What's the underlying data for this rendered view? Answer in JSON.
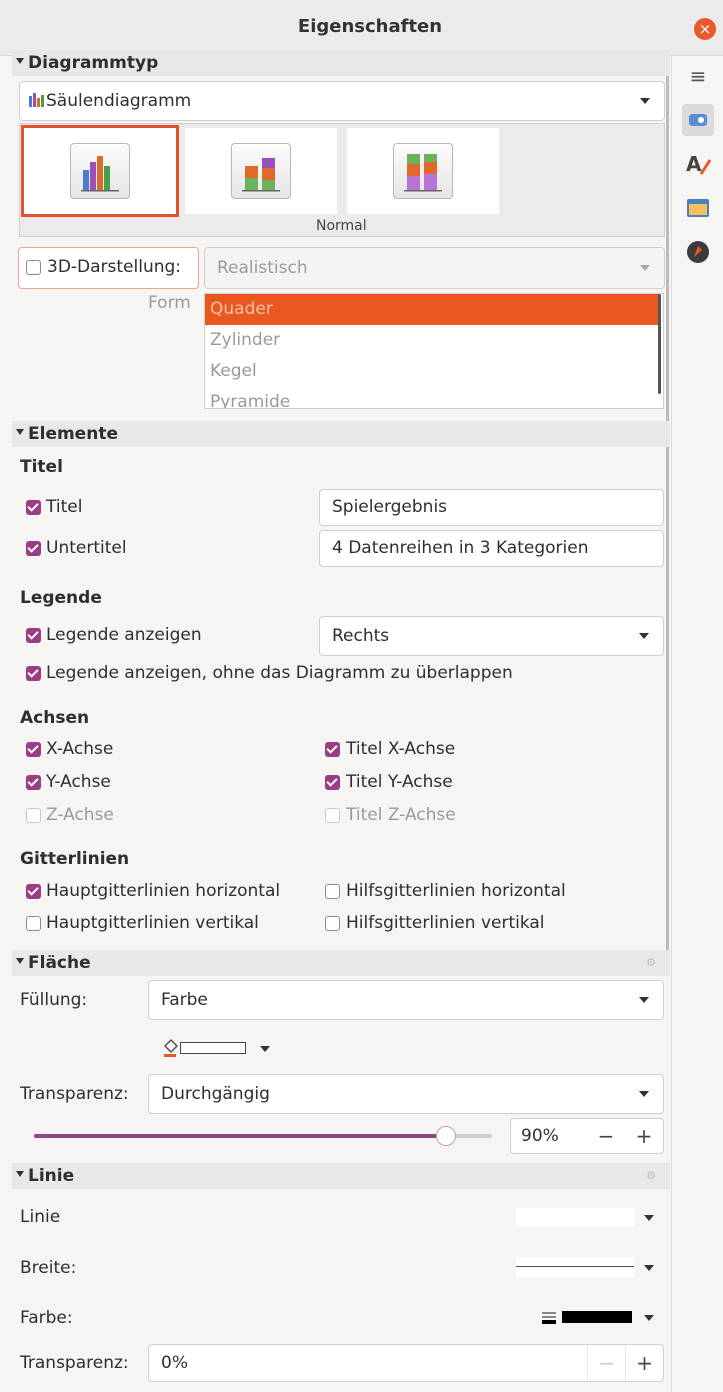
{
  "window": {
    "title": "Eigenschaften",
    "close": "×"
  },
  "sidebar": {
    "menu": "≡"
  },
  "chart_type": {
    "header": "Diagrammtyp",
    "type_value": "Säulendiagramm",
    "variant_label": "Normal",
    "threed_label": "3D-Darstellung:",
    "threed_value": "Realistisch",
    "form_label": "Form",
    "forms": [
      "Quader",
      "Zylinder",
      "Kegel",
      "Pyramide"
    ]
  },
  "elements": {
    "header": "Elemente",
    "title_heading": "Titel",
    "title_cb": "Titel",
    "title_value": "Spielergebnis",
    "subtitle_cb": "Untertitel",
    "subtitle_value": "4 Datenreihen in 3 Kategorien",
    "legend_heading": "Legende",
    "legend_show": "Legende anzeigen",
    "legend_pos": "Rechts",
    "legend_nooverlap": "Legende anzeigen, ohne das Diagramm zu überlappen",
    "axes_heading": "Achsen",
    "x_axis": "X-Achse",
    "y_axis": "Y-Achse",
    "z_axis": "Z-Achse",
    "x_title": "Titel X-Achse",
    "y_title": "Titel Y-Achse",
    "z_title": "Titel Z-Achse",
    "grid_heading": "Gitterlinien",
    "grid_major_h": "Hauptgitterlinien horizontal",
    "grid_minor_h": "Hilfsgitterlinien horizontal",
    "grid_major_v": "Hauptgitterlinien vertikal",
    "grid_minor_v": "Hilfsgitterlinien vertikal"
  },
  "area": {
    "header": "Fläche",
    "fill_label": "Füllung:",
    "fill_value": "Farbe",
    "transp_label": "Transparenz:",
    "transp_value": "Durchgängig",
    "transp_percent": "90%",
    "transp_level": 0.9,
    "minus": "−",
    "plus": "+"
  },
  "line": {
    "header": "Linie",
    "line_label": "Linie",
    "width_label": "Breite:",
    "color_label": "Farbe:",
    "transp_label": "Transparenz:",
    "transp_value": "0%",
    "minus": "−",
    "plus": "+"
  },
  "colors": {
    "accent": "#e9591f",
    "checkbox": "#9b3d85",
    "slider": "#8e4a86"
  }
}
